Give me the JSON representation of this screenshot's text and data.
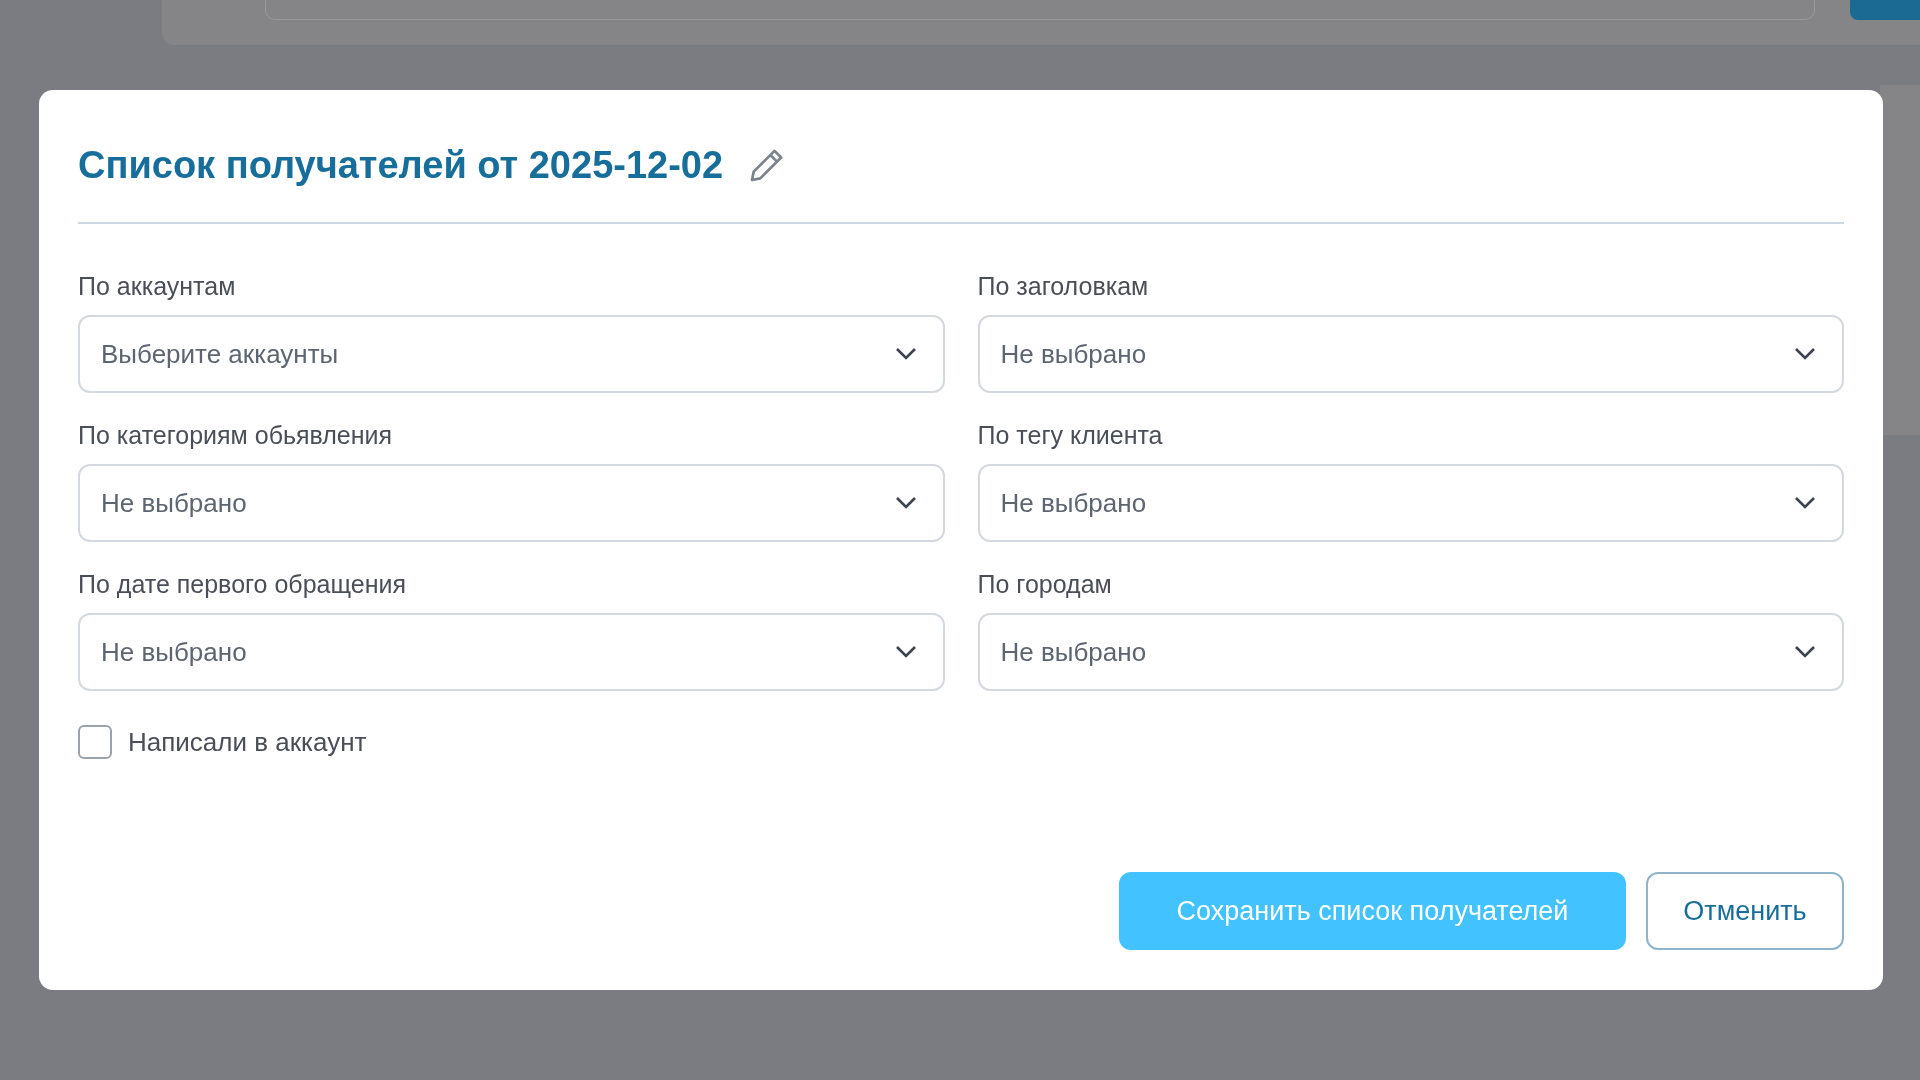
{
  "dialog": {
    "title": "Список получателей от 2025-12-02",
    "filters": [
      {
        "label": "По аккаунтам",
        "placeholder": "Выберите аккаунты"
      },
      {
        "label": "По заголовкам",
        "placeholder": "Не выбрано"
      },
      {
        "label": "По категориям обьявления",
        "placeholder": "Не выбрано"
      },
      {
        "label": "По тегу клиента",
        "placeholder": "Не выбрано"
      },
      {
        "label": "По дате первого обращения",
        "placeholder": "Не выбрано"
      },
      {
        "label": "По городам",
        "placeholder": "Не выбрано"
      }
    ],
    "checkbox": {
      "label": "Написали в аккаунт",
      "checked": false
    },
    "buttons": [
      {
        "label": "Сохранить список получателей",
        "kind": "primary"
      },
      {
        "label": "Отменить",
        "kind": "secondary"
      }
    ]
  }
}
